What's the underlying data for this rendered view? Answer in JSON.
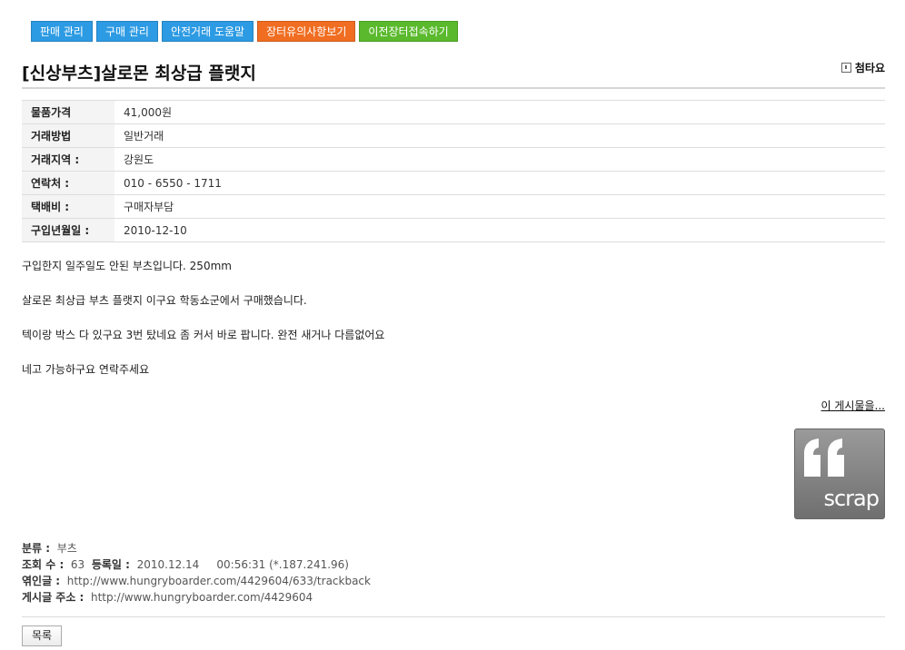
{
  "nav": {
    "buttons": [
      {
        "label": "판매 관리",
        "color": "#2d9be3"
      },
      {
        "label": "구매 관리",
        "color": "#2d9be3"
      },
      {
        "label": "안전거래 도움말",
        "color": "#2d9be3"
      },
      {
        "label": "장터유의사항보기",
        "color": "#f06d21"
      },
      {
        "label": "이전장터접속하기",
        "color": "#5ab92c"
      }
    ]
  },
  "post": {
    "title": "[신상부츠]살로몬 최상급 플랫지",
    "attachments_label": "첨타요"
  },
  "info": {
    "rows": [
      {
        "key": "물품가격",
        "value": "41,000원"
      },
      {
        "key": "거래방법",
        "value": "일반거래"
      },
      {
        "key": "거래지역 :",
        "value": "강원도"
      },
      {
        "key": "연락처 :",
        "value": "010 - 6550 - 1711"
      },
      {
        "key": "택배비 :",
        "value": "구매자부담"
      },
      {
        "key": "구입년월일 :",
        "value": "2010-12-10"
      }
    ]
  },
  "body": {
    "lines": [
      "구입한지 일주일도 안된 부츠입니다.  250mm",
      "살로몬 최상급 부츠 플랫지 이구요 학동쇼군에서 구매했습니다.",
      "텍이랑 박스 다 있구요 3번 탔네요 좀 커서 바로 팝니다. 완전 새거나 다름없어요",
      "네고 가능하구요 연락주세요"
    ]
  },
  "share": {
    "link_label": "이 게시물을...",
    "scrap_label": "scrap"
  },
  "meta": {
    "category_key": "분류 :",
    "category_value": "부츠",
    "views_key": "조회 수 :",
    "views_value": "63",
    "date_key": "등록일 :",
    "date_value": "2010.12.14",
    "time_value": "00:56:31 (*.187.241.96)",
    "trackback_key": "엮인글 :",
    "trackback_url": "http://www.hungryboarder.com/4429604/633/trackback",
    "address_key": "게시글 주소 :",
    "address_url": "http://www.hungryboarder.com/4429604"
  },
  "footer": {
    "list_button": "목록"
  }
}
